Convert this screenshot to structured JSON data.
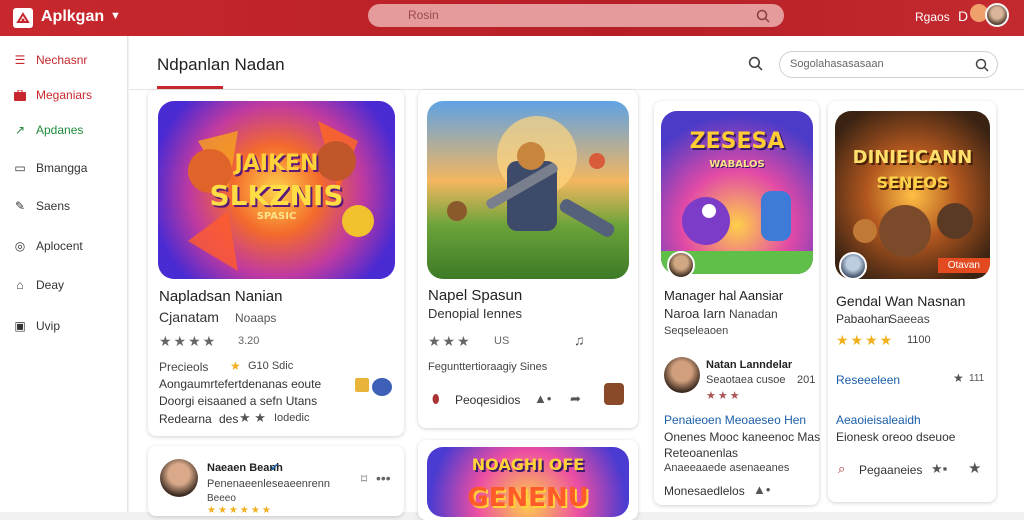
{
  "topbar": {
    "app_title": "Aplkgan",
    "search_placeholder": "Rosin",
    "user_name": "Rgaos",
    "user_initial": "D"
  },
  "sidebar": {
    "items": [
      {
        "label": "Nechasnr",
        "icon": "list-icon"
      },
      {
        "label": "Meganiars",
        "icon": "briefcase-icon"
      },
      {
        "label": "Apdanes",
        "icon": "trend-icon"
      },
      {
        "label": "Bmangga",
        "icon": "chat-icon"
      },
      {
        "label": "Saens",
        "icon": "edit-icon"
      },
      {
        "label": "Aplocent",
        "icon": "globe-icon"
      },
      {
        "label": "Deay",
        "icon": "home-icon"
      },
      {
        "label": "Uvip",
        "icon": "box-icon"
      }
    ]
  },
  "main": {
    "title": "Ndpanlan Nadan",
    "search_placeholder": "Sogolahasasasaan"
  },
  "cards": {
    "c1": {
      "art_line1": "JAIKEN",
      "art_line2": "SLKZNIS",
      "art_line3": "SPASIC",
      "title": "Napladsan Nanian",
      "subtitle": "Cjanatam",
      "subtitle2": "Noaaps",
      "rating_value": "3.20",
      "meta1": "Precieols",
      "meta1b": "G10 Sdic",
      "desc1": "Aongaumrtefertdenanas eoute",
      "desc2": "Doorgi eisaaned a sefn Utans",
      "footer": "Redearna",
      "footer2": "des",
      "footer3": "Iodedic"
    },
    "c2": {
      "title": "Napel Spasun",
      "subtitle": "Denopial Iennes",
      "rating_value": "US",
      "meta1": "Fegunttertioraagiy Sines",
      "footer": "Peoqesidios"
    },
    "c3": {
      "art_line1": "ZESESA",
      "art_line2": "WABALOS",
      "title": "Manager hal Aansiar",
      "subtitle": "Naroa Iarn",
      "subtitle2": "Nanadan",
      "subtitle3": "Seqseleaoen",
      "user_name": "Natan Lanndelar",
      "user_sub": "Seaotaea cusoe",
      "user_extra": "201",
      "desc1": "Penaieoen Meoaeseo Hen",
      "desc2": "Onenes Mooc kaneenoc Mas",
      "desc3": "Reteoanenlas",
      "desc4": "Anaeeaaede asenaeanes",
      "footer": "Monesaedlelos"
    },
    "c4": {
      "art_line1": "DINIEICANN",
      "art_line2": "SENEOS",
      "badge": "Otavan",
      "title": "Gendal Wan Nasnan",
      "subtitle": "Pabaohan",
      "subtitle2": "Saeeas",
      "rating_value": "1100",
      "link": "Reseeeleen",
      "link_extra": "111",
      "desc1": "Aeaoieisaleaidh",
      "desc2": "Eionesk oreoo dseuoe",
      "footer": "Pegaaneies"
    },
    "c5": {
      "user_name": "Naeaen Beanh",
      "user_sub": "Penenaeenleseaeenrenn",
      "user_extra": "Beeeo"
    },
    "c6": {
      "art_line1": "NOAGHI OFE",
      "art_line2": "GENENU"
    }
  },
  "colors": {
    "brand": "#c8282d",
    "star": "#f2b01e",
    "link": "#1a5ea8"
  }
}
